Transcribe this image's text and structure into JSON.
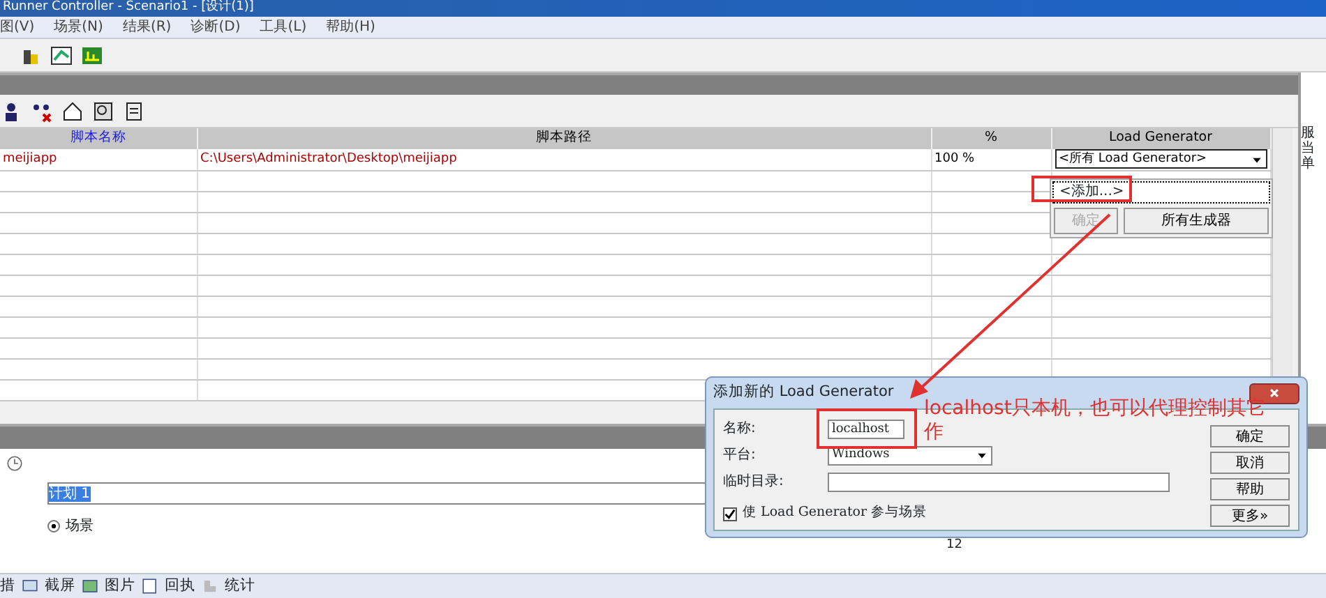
{
  "window": {
    "title": "Runner Controller - Scenario1 - [设计(1)]"
  },
  "menu": [
    {
      "label": "图(V)"
    },
    {
      "label": "场景(N)"
    },
    {
      "label": "结果(R)"
    },
    {
      "label": "诊断(D)"
    },
    {
      "label": "工具(L)"
    },
    {
      "label": "帮助(H)"
    }
  ],
  "scripts_table": {
    "columns": [
      {
        "label": "脚本名称",
        "selected": true
      },
      {
        "label": "脚本路径",
        "selected": false
      },
      {
        "label": "%",
        "selected": false
      },
      {
        "label": "Load Generator",
        "selected": false
      }
    ],
    "rows": [
      {
        "name": "meijiapp",
        "path": "C:\\Users\\Administrator\\Desktop\\meijiapp",
        "percent": "100 %",
        "load_generator": "<所有 Load Generator>"
      }
    ]
  },
  "lg_dropdown": {
    "items": [
      {
        "label": "<添加...>",
        "highlighted": true
      }
    ],
    "buttons": [
      {
        "label": "确定",
        "disabled": true
      },
      {
        "label": "所有生成器",
        "disabled": false
      }
    ]
  },
  "side_panel": {
    "lines": [
      "服",
      "当",
      "单"
    ]
  },
  "schedule": {
    "name_value": "计划 1",
    "options": [
      {
        "label": "场景",
        "selected": true
      }
    ]
  },
  "chart_axis_label": "12",
  "bottom_tabs": [
    {
      "label": "措"
    },
    {
      "label": "截屏"
    },
    {
      "label": "图片"
    },
    {
      "label": "回执"
    },
    {
      "label": "统计"
    }
  ],
  "dialog": {
    "title": "添加新的 Load Generator",
    "fields": [
      {
        "kind": "text",
        "label": "名称:",
        "value": "localhost"
      },
      {
        "kind": "select",
        "label": "平台:",
        "value": "Windows"
      },
      {
        "kind": "text",
        "label": "临时目录:"
      }
    ],
    "checkbox": {
      "label": "使 Load Generator 参与场景",
      "checked": true
    },
    "buttons": [
      "确定",
      "取消",
      "帮助",
      "更多»"
    ]
  },
  "annotation": {
    "lines": [
      "localhost只本机，也可以代理控制其它",
      "作"
    ]
  }
}
